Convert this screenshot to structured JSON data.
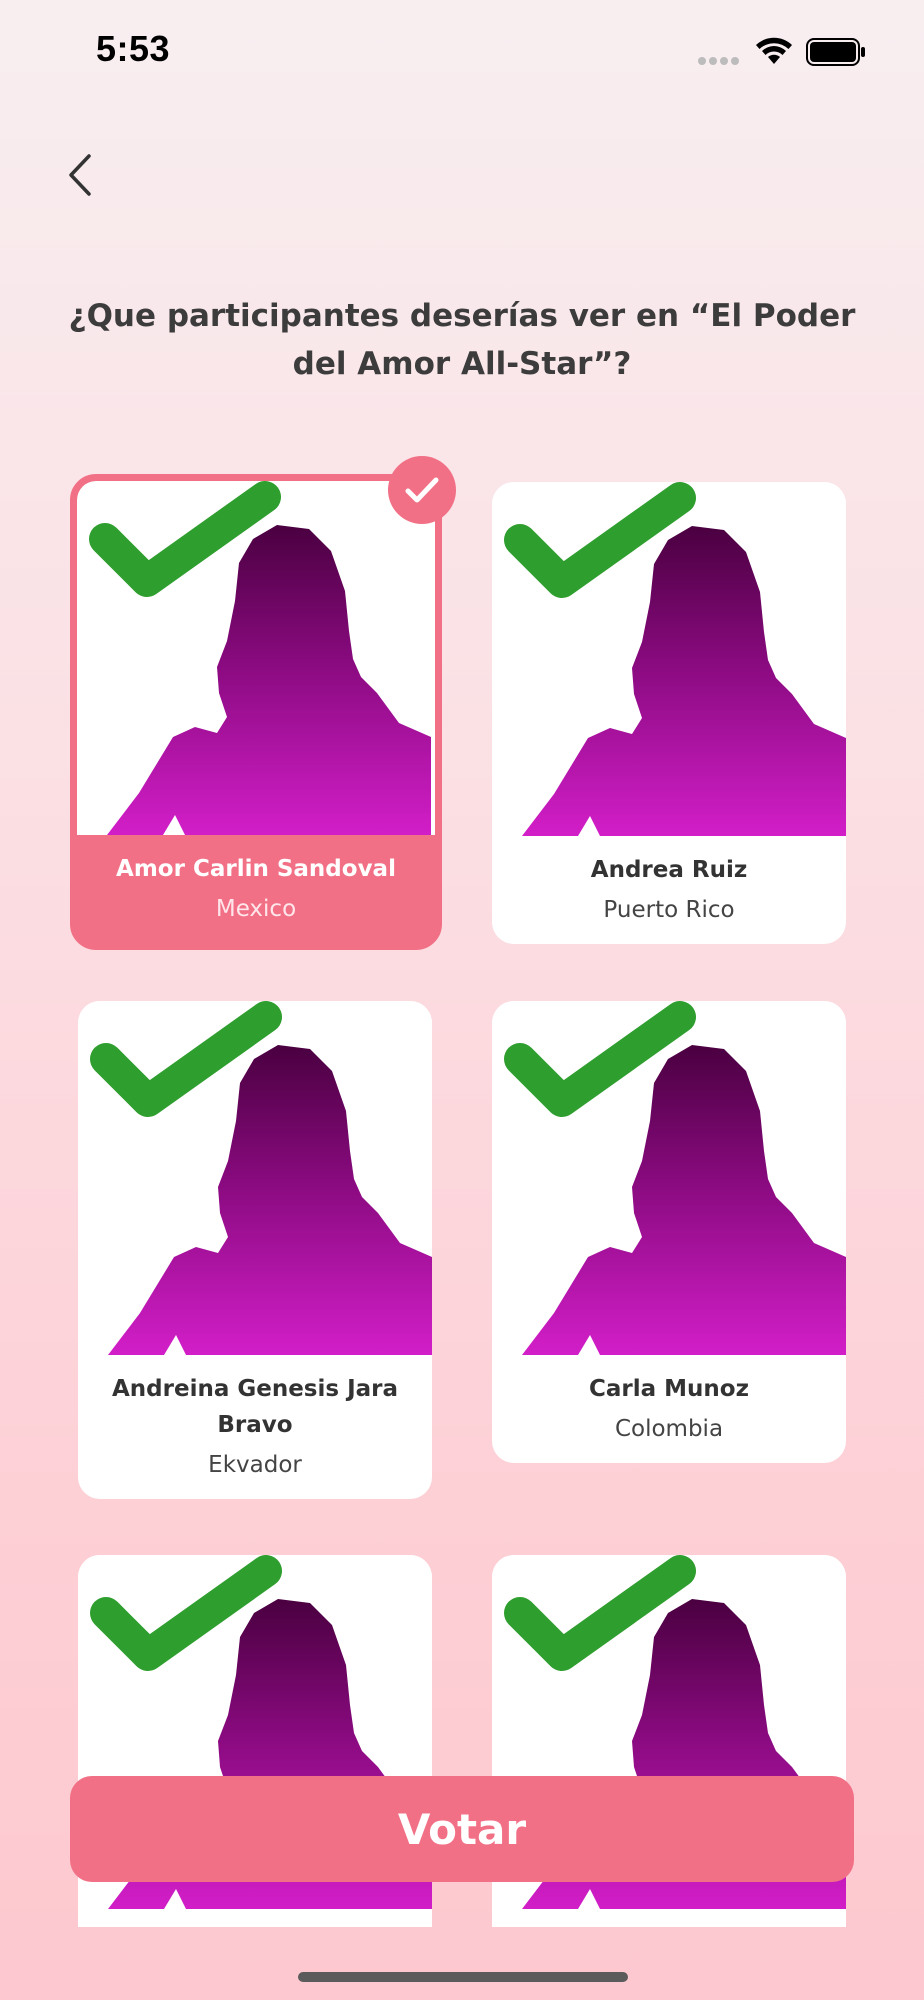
{
  "status_bar": {
    "time": "5:53",
    "wifi_icon": "wifi-icon",
    "battery_icon": "battery-icon"
  },
  "nav": {
    "back_icon": "chevron-left-icon"
  },
  "question": "¿Que participantes deserías ver en “El Poder del Amor All-Star”?",
  "participants": [
    {
      "name": "Amor Carlin Sandoval",
      "country": "Mexico",
      "selected": true
    },
    {
      "name": "Andrea Ruiz",
      "country": "Puerto Rico",
      "selected": false
    },
    {
      "name": "Andreina Genesis Jara Bravo",
      "country": "Ekvador",
      "selected": false
    },
    {
      "name": "Carla Munoz",
      "country": "Colombia",
      "selected": false
    },
    {
      "name": "",
      "country": "",
      "selected": false
    },
    {
      "name": "",
      "country": "",
      "selected": false
    }
  ],
  "vote_button": {
    "label": "Votar"
  },
  "colors": {
    "accent": "#f27086",
    "check_green": "#2e9e2e",
    "silhouette_top": "#4a0040",
    "silhouette_bottom": "#d21ec8"
  }
}
